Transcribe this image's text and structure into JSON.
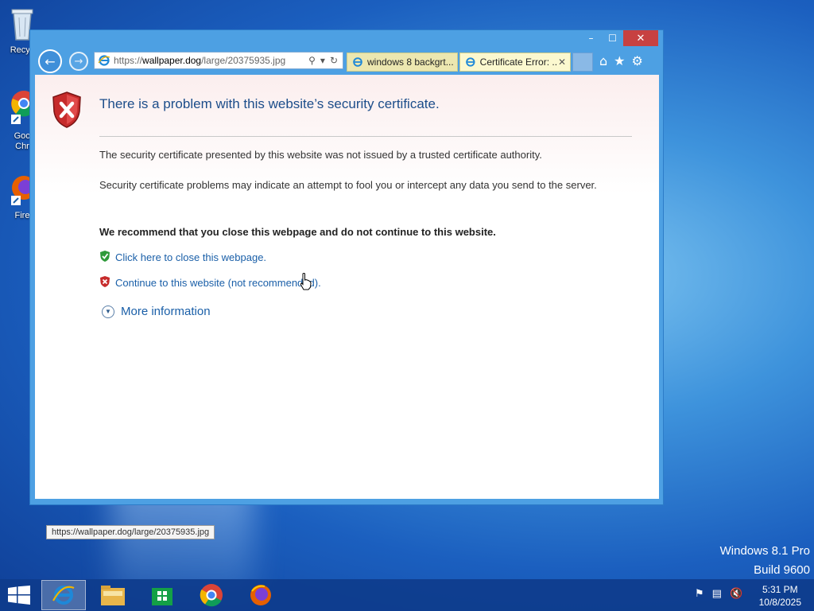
{
  "desktop": {
    "icons": [
      {
        "label": "Recyc",
        "icon": "recycle-bin-icon"
      },
      {
        "label": "Goo Chr",
        "icon": "chrome-icon"
      },
      {
        "label": "Fire",
        "icon": "firefox-icon"
      }
    ],
    "watermark": {
      "line1": "Windows 8.1 Pro",
      "line2": "Build 9600"
    }
  },
  "browser": {
    "address_bar": {
      "protocol": "https://",
      "domain": "wallpaper.dog",
      "path": "/large/20375935.jpg"
    },
    "tabs": [
      {
        "label": "windows 8 backgrt...",
        "active": false
      },
      {
        "label": "Certificate Error: ...",
        "active": true
      }
    ],
    "window_controls": {
      "minimize": "–",
      "maximize": "☐",
      "close": "✕"
    }
  },
  "page": {
    "title": "There is a problem with this website’s security certificate.",
    "para1": "The security certificate presented by this website was not issued by a trusted certificate authority.",
    "para2": "Security certificate problems may indicate an attempt to fool you or intercept any data you send to the server.",
    "recommend": "We recommend that you close this webpage and do not continue to this website.",
    "link_close": "Click here to close this webpage.",
    "link_continue": "Continue to this website (not recommended).",
    "more_info": "More information",
    "status_url": "https://wallpaper.dog/large/20375935.jpg"
  },
  "taskbar": {
    "apps": [
      "internet-explorer",
      "file-explorer",
      "store",
      "chrome",
      "firefox"
    ],
    "clock_time": "5:31 PM",
    "clock_date": "10/8/2025"
  },
  "colors": {
    "close_red": "#c74141",
    "link_blue": "#1a5fa8",
    "title_blue": "#1c4d8a"
  }
}
